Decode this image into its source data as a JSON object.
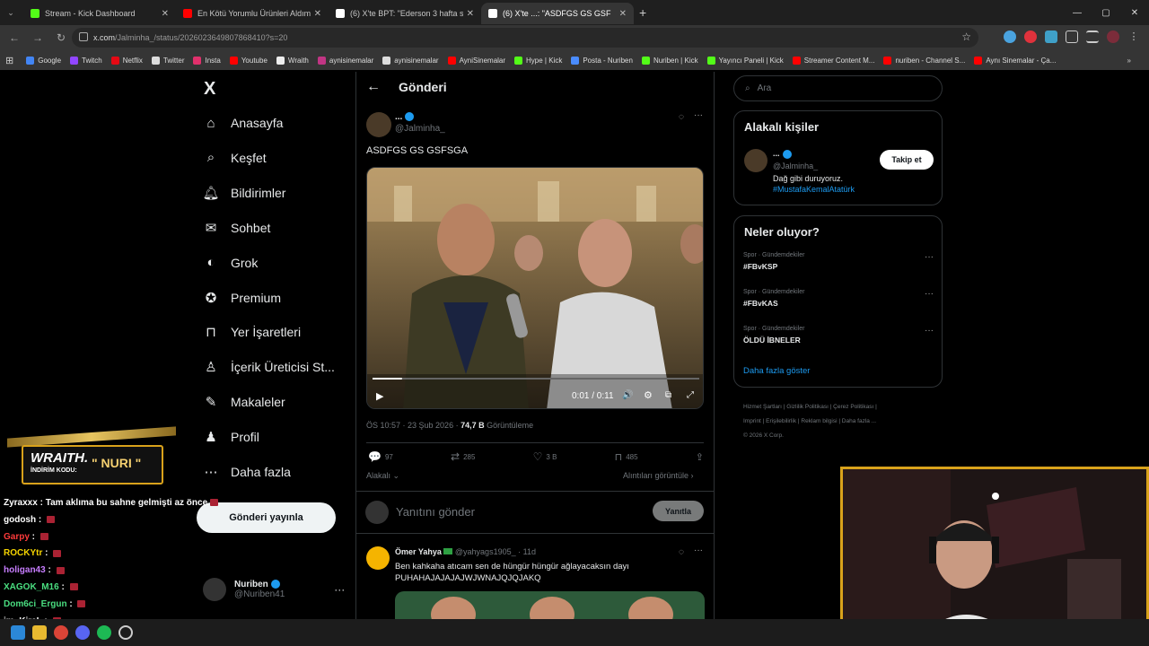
{
  "browser": {
    "tabs": [
      {
        "title": "Stream - Kick Dashboard",
        "color": "#53fc18"
      },
      {
        "title": "En Kötü Yorumlu Ürünleri Aldım",
        "color": "#ff0000"
      },
      {
        "title": "(6) X'te BPT: \"Ederson 3 hafta s",
        "color": "#ffffff"
      },
      {
        "title": "(6) X'te ...: \"ASDFGS GS GSF",
        "color": "#ffffff"
      }
    ],
    "url_main": "x.com",
    "url_path": "/Jalminha_/status/2026023649807868410?s=20",
    "bookmarks": [
      "Google",
      "Twitch",
      "Netflix",
      "Twitter",
      "Insta",
      "Youtube",
      "Wraith",
      "aynisinemalar",
      "aynisinemalar",
      "AyniSinemalar",
      "Hype | Kick",
      "Posta - Nuriben",
      "Nuriben | Kick",
      "Yayıncı Paneli | Kick",
      "Streamer Content M...",
      "nuriben - Channel S...",
      "Aynı Sinemalar - Ça..."
    ]
  },
  "nav": {
    "logo": "X",
    "items": [
      "Anasayfa",
      "Keşfet",
      "Bildirimler",
      "Sohbet",
      "Grok",
      "Premium",
      "Yer İşaretleri",
      "İçerik Üreticisi St...",
      "Makaleler",
      "Profil",
      "Daha fazla"
    ],
    "post_button": "Gönderi yayınla",
    "user_name": "Nuriben",
    "user_handle": "@Nuriben41"
  },
  "post": {
    "header": "Gönderi",
    "author": "...",
    "handle": "@Jalminha_",
    "text": "ASDFGS GS GSFSGA",
    "video_time": "0:01 / 0:11",
    "video_progress": 0.09,
    "meta_time": "ÖS 10:57 · 23 Şub 2026 · ",
    "views": "74,7 B",
    "views_label": " Görüntüleme",
    "replies": "97",
    "reposts": "285",
    "likes": "3 B",
    "bookmarks": "485",
    "relevant": "Alakalı",
    "quotes": "Alıntıları görüntüle",
    "reply_placeholder": "Yanıtını gönder",
    "reply_button": "Yanıtla"
  },
  "reply_item": {
    "name": "Ömer Yahya",
    "handle": "@yahyags1905_",
    "age": "· 11d",
    "line1": "Ben kahkaha atıcam sen de hüngür hüngür ağlayacaksın dayı",
    "line2": "PUHAHAJAJAJAJWJWNAJQJQJAKQ"
  },
  "sidebar": {
    "search_placeholder": "Ara",
    "related_title": "Alakalı kişiler",
    "person_name": "...",
    "person_handle": "@Jalminha_",
    "follow": "Takip et",
    "bio": "Dağ gibi duruyoruz.",
    "bio_tag": "#MustafaKemalAtatürk",
    "trends_title": "Neler oluyor?",
    "trends": [
      {
        "cat": "Spor · Gündemdekiler",
        "name": "#FBvKSP"
      },
      {
        "cat": "Spor · Gündemdekiler",
        "name": "#FBvKAS"
      },
      {
        "cat": "Spor · Gündemdekiler",
        "name": "ÖLDÜ İBNELER"
      }
    ],
    "show_more": "Daha fazla göster",
    "footer1": "Hizmet Şartları  |  Gizlilik Politikası  |  Çerez Politikası  |",
    "footer2": "Imprint  |  Erişilebilirlik  |  Reklam bilgisi  |  Daha fazla ...",
    "footer3": "© 2026 X Corp."
  },
  "overlay": {
    "banner_title": "WRAITH.",
    "banner_code_label": "İNDİRİM KODU:",
    "banner_code": "\" NURI \"",
    "chat": [
      {
        "user": "Zyraxxx",
        "color": "#ffffff",
        "msg": "Tam aklıma bu sahne gelmişti az önce"
      },
      {
        "user": "godosh",
        "color": "#ffffff",
        "msg": ""
      },
      {
        "user": "Garpy",
        "color": "#ff3b3b",
        "msg": ""
      },
      {
        "user": "ROCKYtr",
        "color": "#f5d400",
        "msg": ""
      },
      {
        "user": "holigan43",
        "color": "#c77dff",
        "msg": ""
      },
      {
        "user": "XAGOK_M16",
        "color": "#4ade80",
        "msg": ""
      },
      {
        "user": "Dom6ci_Ergun",
        "color": "#4ade80",
        "msg": ""
      },
      {
        "user": "im_KiraL",
        "color": "#ffffff",
        "msg": ""
      }
    ]
  }
}
